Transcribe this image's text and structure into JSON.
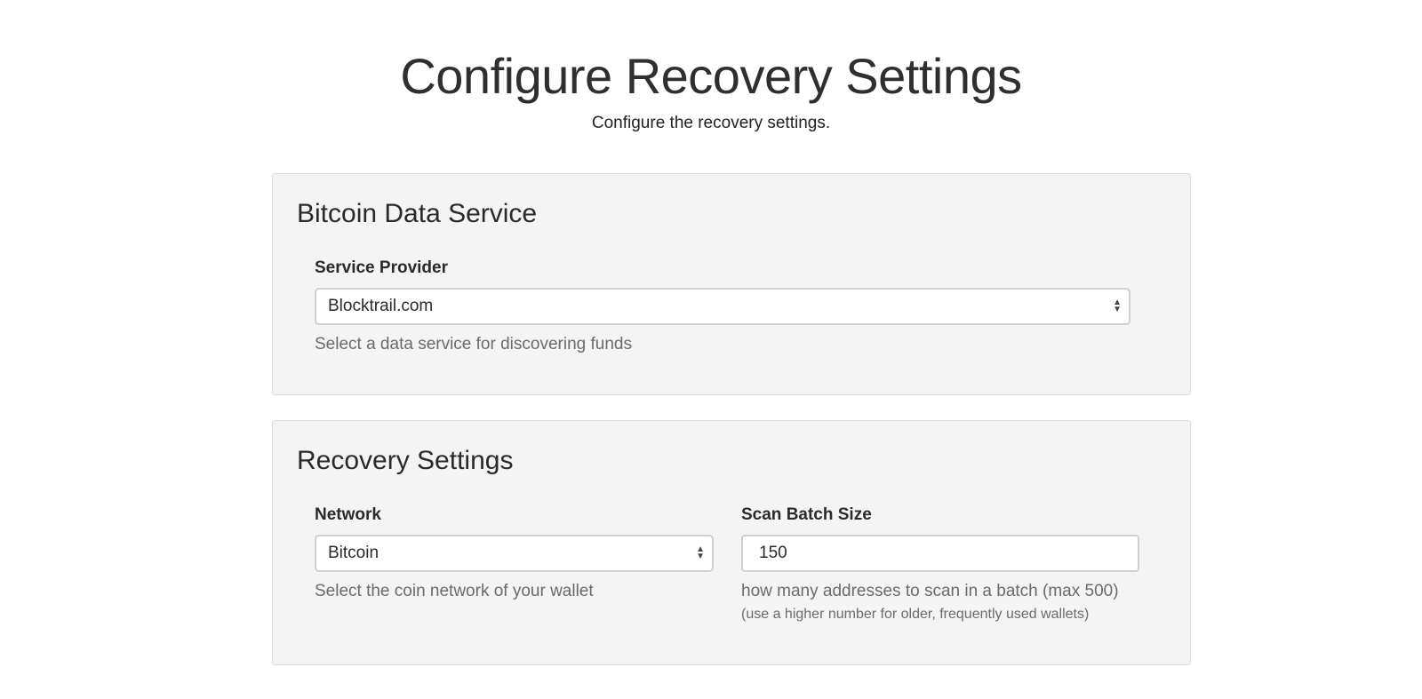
{
  "header": {
    "title": "Configure Recovery Settings",
    "subtitle": "Configure the recovery settings."
  },
  "data_service": {
    "title": "Bitcoin Data Service",
    "provider_label": "Service Provider",
    "provider_value": "Blocktrail.com",
    "provider_help": "Select a data service for discovering funds"
  },
  "recovery": {
    "title": "Recovery Settings",
    "network_label": "Network",
    "network_value": "Bitcoin",
    "network_help": "Select the coin network of your wallet",
    "batch_label": "Scan Batch Size",
    "batch_value": "150",
    "batch_help": "how many addresses to scan in a batch (max 500)",
    "batch_subhelp": "(use a higher number for older, frequently used wallets)"
  },
  "icons": {
    "select_arrows": "updown-chevron-icon"
  },
  "colors": {
    "panel_background": "#f4f4f4",
    "panel_border": "#dcdcdc",
    "input_border": "#cfcfcf",
    "help_text": "#6b6b6b"
  }
}
